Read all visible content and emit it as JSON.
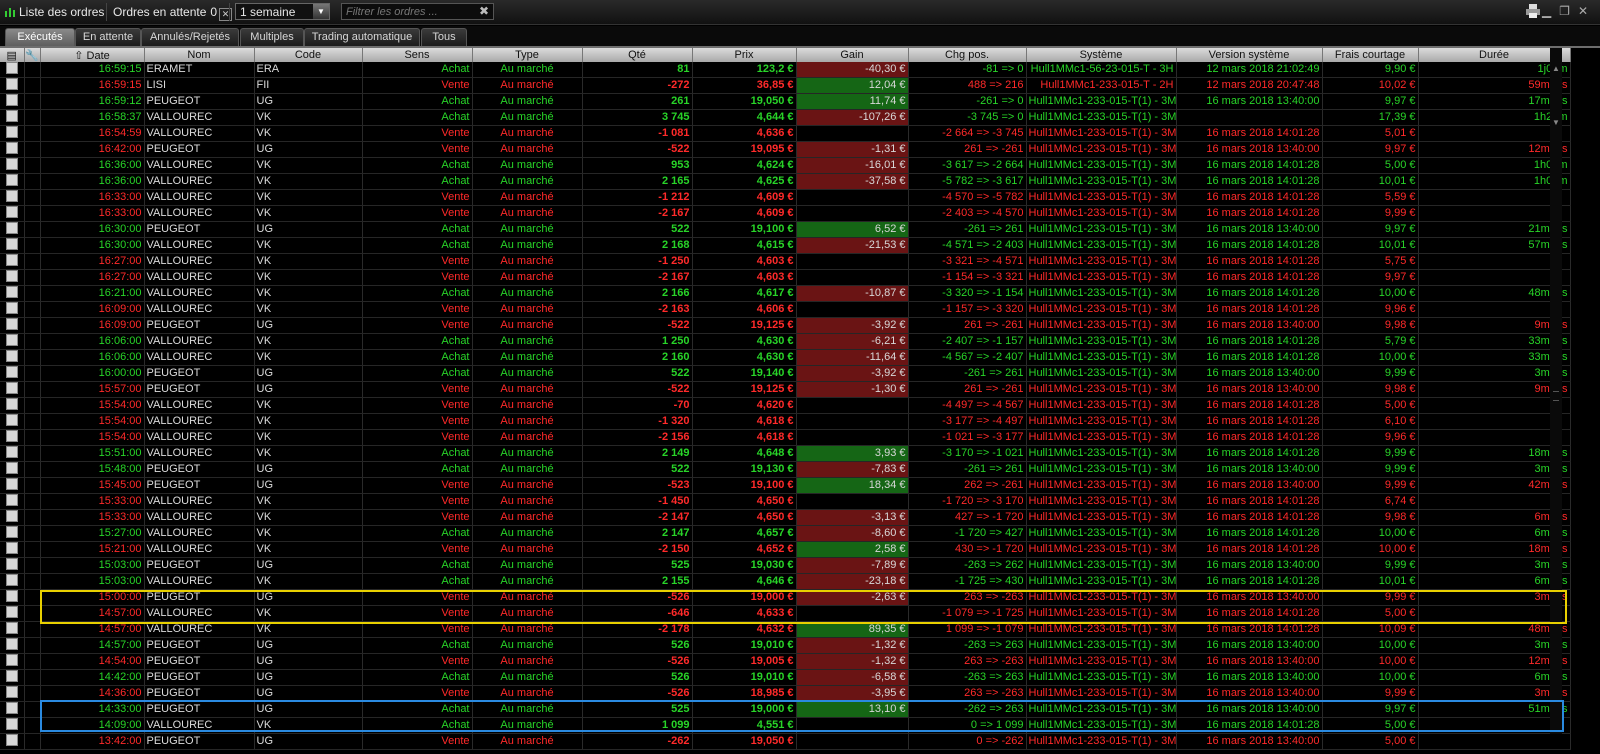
{
  "topbar": {
    "title": "Liste des ordres",
    "pending_label": "Ordres en attente",
    "pending_count": "0",
    "period": "1 semaine",
    "filter_placeholder": "Filtrer les ordres ..."
  },
  "tabs": [
    "Exécutés",
    "En attente",
    "Annulés/Rejetés",
    "Multiples",
    "Trading automatique",
    "Tous"
  ],
  "columns": [
    "Date",
    "Nom",
    "Code",
    "Sens",
    "Type",
    "Qté",
    "Prix",
    "Gain",
    "Chg pos.",
    "Système",
    "Version système",
    "Frais courtage",
    "Durée"
  ],
  "rows": [
    [
      "16:59:15",
      "ERAMET",
      "ERA",
      "Achat",
      "Au marché",
      "81",
      "123,2 €",
      "-40,30 €",
      "-81 => 0",
      "Hull1MMc1-56-23-015-T - 3H",
      "12 mars 2018 21:02:49",
      "9,90 €",
      "1j01m"
    ],
    [
      "16:59:15",
      "LISI",
      "FII",
      "Vente",
      "Au marché",
      "-272",
      "36,85 €",
      "12,04 €",
      "488 => 216",
      "Hull1MMc1-233-015-T - 2H",
      "12 mars 2018 20:47:48",
      "10,02 €",
      "59m14s"
    ],
    [
      "16:59:12",
      "PEUGEOT",
      "UG",
      "Achat",
      "Au marché",
      "261",
      "19,050 €",
      "11,74 €",
      "-261 => 0",
      "Hull1MMc1-233-015-T(1) - 3M",
      "16 mars 2018 13:40:00",
      "9,97 €",
      "17m12s"
    ],
    [
      "16:58:37",
      "VALLOUREC",
      "VK",
      "Achat",
      "Au marché",
      "3 745",
      "4,644 €",
      "-107,26 €",
      "-3 745 => 0",
      "Hull1MMc1-233-015-T(1) - 3M",
      "",
      "17,39 €",
      "1h25m"
    ],
    [
      "16:54:59",
      "VALLOUREC",
      "VK",
      "Vente",
      "Au marché",
      "-1 081",
      "4,636 €",
      "",
      "-2 664 => -3 745",
      "Hull1MMc1-233-015-T(1) - 3M",
      "16 mars 2018 14:01:28",
      "5,01 €",
      ""
    ],
    [
      "16:42:00",
      "PEUGEOT",
      "UG",
      "Vente",
      "Au marché",
      "-522",
      "19,095 €",
      "-1,31 €",
      "261 => -261",
      "Hull1MMc1-233-015-T(1) - 3M",
      "16 mars 2018 13:40:00",
      "9,97 €",
      "12m00s"
    ],
    [
      "16:36:00",
      "VALLOUREC",
      "VK",
      "Achat",
      "Au marché",
      "953",
      "4,624 €",
      "-16,01 €",
      "-3 617 => -2 664",
      "Hull1MMc1-233-015-T(1) - 3M",
      "16 mars 2018 14:01:28",
      "5,00 €",
      "1h03m"
    ],
    [
      "16:36:00",
      "VALLOUREC",
      "VK",
      "Achat",
      "Au marché",
      "2 165",
      "4,625 €",
      "-37,58 €",
      "-5 782 => -3 617",
      "Hull1MMc1-233-015-T(1) - 3M",
      "16 mars 2018 14:01:28",
      "10,01 €",
      "1h03m"
    ],
    [
      "16:33:00",
      "VALLOUREC",
      "VK",
      "Vente",
      "Au marché",
      "-1 212",
      "4,609 €",
      "",
      "-4 570 => -5 782",
      "Hull1MMc1-233-015-T(1) - 3M",
      "16 mars 2018 14:01:28",
      "5,59 €",
      ""
    ],
    [
      "16:33:00",
      "VALLOUREC",
      "VK",
      "Vente",
      "Au marché",
      "-2 167",
      "4,609 €",
      "",
      "-2 403 => -4 570",
      "Hull1MMc1-233-015-T(1) - 3M",
      "16 mars 2018 14:01:28",
      "9,99 €",
      ""
    ],
    [
      "16:30:00",
      "PEUGEOT",
      "UG",
      "Achat",
      "Au marché",
      "522",
      "19,100 €",
      "6,52 €",
      "-261 => 261",
      "Hull1MMc1-233-015-T(1) - 3M",
      "16 mars 2018 13:40:00",
      "9,97 €",
      "21m00s"
    ],
    [
      "16:30:00",
      "VALLOUREC",
      "VK",
      "Achat",
      "Au marché",
      "2 168",
      "4,615 €",
      "-21,53 €",
      "-4 571 => -2 403",
      "Hull1MMc1-233-015-T(1) - 3M",
      "16 mars 2018 14:01:28",
      "10,01 €",
      "57m00s"
    ],
    [
      "16:27:00",
      "VALLOUREC",
      "VK",
      "Vente",
      "Au marché",
      "-1 250",
      "4,603 €",
      "",
      "-3 321 => -4 571",
      "Hull1MMc1-233-015-T(1) - 3M",
      "16 mars 2018 14:01:28",
      "5,75 €",
      ""
    ],
    [
      "16:27:00",
      "VALLOUREC",
      "VK",
      "Vente",
      "Au marché",
      "-2 167",
      "4,603 €",
      "",
      "-1 154 => -3 321",
      "Hull1MMc1-233-015-T(1) - 3M",
      "16 mars 2018 14:01:28",
      "9,97 €",
      ""
    ],
    [
      "16:21:00",
      "VALLOUREC",
      "VK",
      "Achat",
      "Au marché",
      "2 166",
      "4,617 €",
      "-10,87 €",
      "-3 320 => -1 154",
      "Hull1MMc1-233-015-T(1) - 3M",
      "16 mars 2018 14:01:28",
      "10,00 €",
      "48m00s"
    ],
    [
      "16:09:00",
      "VALLOUREC",
      "VK",
      "Vente",
      "Au marché",
      "-2 163",
      "4,606 €",
      "",
      "-1 157 => -3 320",
      "Hull1MMc1-233-015-T(1) - 3M",
      "16 mars 2018 14:01:28",
      "9,96 €",
      ""
    ],
    [
      "16:09:00",
      "PEUGEOT",
      "UG",
      "Vente",
      "Au marché",
      "-522",
      "19,125 €",
      "-3,92 €",
      "261 => -261",
      "Hull1MMc1-233-015-T(1) - 3M",
      "16 mars 2018 13:40:00",
      "9,98 €",
      "9m00s"
    ],
    [
      "16:06:00",
      "VALLOUREC",
      "VK",
      "Achat",
      "Au marché",
      "1 250",
      "4,630 €",
      "-6,21 €",
      "-2 407 => -1 157",
      "Hull1MMc1-233-015-T(1) - 3M",
      "16 mars 2018 14:01:28",
      "5,79 €",
      "33m00s"
    ],
    [
      "16:06:00",
      "VALLOUREC",
      "VK",
      "Achat",
      "Au marché",
      "2 160",
      "4,630 €",
      "-11,64 €",
      "-4 567 => -2 407",
      "Hull1MMc1-233-015-T(1) - 3M",
      "16 mars 2018 14:01:28",
      "10,00 €",
      "33m00s"
    ],
    [
      "16:00:00",
      "PEUGEOT",
      "UG",
      "Achat",
      "Au marché",
      "522",
      "19,140 €",
      "-3,92 €",
      "-261 => 261",
      "Hull1MMc1-233-015-T(1) - 3M",
      "16 mars 2018 13:40:00",
      "9,99 €",
      "3m00s"
    ],
    [
      "15:57:00",
      "PEUGEOT",
      "UG",
      "Vente",
      "Au marché",
      "-522",
      "19,125 €",
      "-1,30 €",
      "261 => -261",
      "Hull1MMc1-233-015-T(1) - 3M",
      "16 mars 2018 13:40:00",
      "9,98 €",
      "9m00s"
    ],
    [
      "15:54:00",
      "VALLOUREC",
      "VK",
      "Vente",
      "Au marché",
      "-70",
      "4,620 €",
      "",
      "-4 497 => -4 567",
      "Hull1MMc1-233-015-T(1) - 3M",
      "16 mars 2018 14:01:28",
      "5,00 €",
      ""
    ],
    [
      "15:54:00",
      "VALLOUREC",
      "VK",
      "Vente",
      "Au marché",
      "-1 320",
      "4,618 €",
      "",
      "-3 177 => -4 497",
      "Hull1MMc1-233-015-T(1) - 3M",
      "16 mars 2018 14:01:28",
      "6,10 €",
      ""
    ],
    [
      "15:54:00",
      "VALLOUREC",
      "VK",
      "Vente",
      "Au marché",
      "-2 156",
      "4,618 €",
      "",
      "-1 021 => -3 177",
      "Hull1MMc1-233-015-T(1) - 3M",
      "16 mars 2018 14:01:28",
      "9,96 €",
      ""
    ],
    [
      "15:51:00",
      "VALLOUREC",
      "VK",
      "Achat",
      "Au marché",
      "2 149",
      "4,648 €",
      "3,93 €",
      "-3 170 => -1 021",
      "Hull1MMc1-233-015-T(1) - 3M",
      "16 mars 2018 14:01:28",
      "9,99 €",
      "18m00s"
    ],
    [
      "15:48:00",
      "PEUGEOT",
      "UG",
      "Achat",
      "Au marché",
      "522",
      "19,130 €",
      "-7,83 €",
      "-261 => 261",
      "Hull1MMc1-233-015-T(1) - 3M",
      "16 mars 2018 13:40:00",
      "9,99 €",
      "3m00s"
    ],
    [
      "15:45:00",
      "PEUGEOT",
      "UG",
      "Vente",
      "Au marché",
      "-523",
      "19,100 €",
      "18,34 €",
      "262 => -261",
      "Hull1MMc1-233-015-T(1) - 3M",
      "16 mars 2018 13:40:00",
      "9,99 €",
      "42m00s"
    ],
    [
      "15:33:00",
      "VALLOUREC",
      "VK",
      "Vente",
      "Au marché",
      "-1 450",
      "4,650 €",
      "",
      "-1 720 => -3 170",
      "Hull1MMc1-233-015-T(1) - 3M",
      "16 mars 2018 14:01:28",
      "6,74 €",
      ""
    ],
    [
      "15:33:00",
      "VALLOUREC",
      "VK",
      "Vente",
      "Au marché",
      "-2 147",
      "4,650 €",
      "-3,13 €",
      "427 => -1 720",
      "Hull1MMc1-233-015-T(1) - 3M",
      "16 mars 2018 14:01:28",
      "9,98 €",
      "6m00s"
    ],
    [
      "15:27:00",
      "VALLOUREC",
      "VK",
      "Achat",
      "Au marché",
      "2 147",
      "4,657 €",
      "-8,60 €",
      "-1 720 => 427",
      "Hull1MMc1-233-015-T(1) - 3M",
      "16 mars 2018 14:01:28",
      "10,00 €",
      "6m00s"
    ],
    [
      "15:21:00",
      "VALLOUREC",
      "VK",
      "Vente",
      "Au marché",
      "-2 150",
      "4,652 €",
      "2,58 €",
      "430 => -1 720",
      "Hull1MMc1-233-015-T(1) - 3M",
      "16 mars 2018 14:01:28",
      "10,00 €",
      "18m00s"
    ],
    [
      "15:03:00",
      "PEUGEOT",
      "UG",
      "Achat",
      "Au marché",
      "525",
      "19,030 €",
      "-7,89 €",
      "-263 => 262",
      "Hull1MMc1-233-015-T(1) - 3M",
      "16 mars 2018 13:40:00",
      "9,99 €",
      "3m00s"
    ],
    [
      "15:03:00",
      "VALLOUREC",
      "VK",
      "Achat",
      "Au marché",
      "2 155",
      "4,646 €",
      "-23,18 €",
      "-1 725 => 430",
      "Hull1MMc1-233-015-T(1) - 3M",
      "16 mars 2018 14:01:28",
      "10,01 €",
      "6m00s"
    ],
    [
      "15:00:00",
      "PEUGEOT",
      "UG",
      "Vente",
      "Au marché",
      "-526",
      "19,000 €",
      "-2,63 €",
      "263 => -263",
      "Hull1MMc1-233-015-T(1) - 3M",
      "16 mars 2018 13:40:00",
      "9,99 €",
      "3m00s"
    ],
    [
      "14:57:00",
      "VALLOUREC",
      "VK",
      "Vente",
      "Au marché",
      "-646",
      "4,633 €",
      "",
      "-1 079 => -1 725",
      "Hull1MMc1-233-015-T(1) - 3M",
      "16 mars 2018 14:01:28",
      "5,00 €",
      ""
    ],
    [
      "14:57:00",
      "VALLOUREC",
      "VK",
      "Vente",
      "Au marché",
      "-2 178",
      "4,632 €",
      "89,35 €",
      "1 099 => -1 079",
      "Hull1MMc1-233-015-T(1) - 3M",
      "16 mars 2018 14:01:28",
      "10,09 €",
      "48m00s"
    ],
    [
      "14:57:00",
      "PEUGEOT",
      "UG",
      "Achat",
      "Au marché",
      "526",
      "19,010 €",
      "-1,32 €",
      "-263 => 263",
      "Hull1MMc1-233-015-T(1) - 3M",
      "16 mars 2018 13:40:00",
      "10,00 €",
      "3m00s"
    ],
    [
      "14:54:00",
      "PEUGEOT",
      "UG",
      "Vente",
      "Au marché",
      "-526",
      "19,005 €",
      "-1,32 €",
      "263 => -263",
      "Hull1MMc1-233-015-T(1) - 3M",
      "16 mars 2018 13:40:00",
      "10,00 €",
      "12m00s"
    ],
    [
      "14:42:00",
      "PEUGEOT",
      "UG",
      "Achat",
      "Au marché",
      "526",
      "19,010 €",
      "-6,58 €",
      "-263 => 263",
      "Hull1MMc1-233-015-T(1) - 3M",
      "16 mars 2018 13:40:00",
      "10,00 €",
      "6m00s"
    ],
    [
      "14:36:00",
      "PEUGEOT",
      "UG",
      "Vente",
      "Au marché",
      "-526",
      "18,985 €",
      "-3,95 €",
      "263 => -263",
      "Hull1MMc1-233-015-T(1) - 3M",
      "16 mars 2018 13:40:00",
      "9,99 €",
      "3m00s"
    ],
    [
      "14:33:00",
      "PEUGEOT",
      "UG",
      "Achat",
      "Au marché",
      "525",
      "19,000 €",
      "13,10 €",
      "-262 => 263",
      "Hull1MMc1-233-015-T(1) - 3M",
      "16 mars 2018 13:40:00",
      "9,97 €",
      "51m00s"
    ],
    [
      "14:09:00",
      "VALLOUREC",
      "VK",
      "Achat",
      "Au marché",
      "1 099",
      "4,551 €",
      "",
      "0 => 1 099",
      "Hull1MMc1-233-015-T(1) - 3M",
      "16 mars 2018 14:01:28",
      "5,00 €",
      ""
    ],
    [
      "13:42:00",
      "PEUGEOT",
      "UG",
      "Vente",
      "Au marché",
      "-262",
      "19,050 €",
      "",
      "0 => -262",
      "Hull1MMc1-233-015-T(1) - 3M",
      "16 mars 2018 13:40:00",
      "5,00 €",
      ""
    ]
  ],
  "colors": {
    "buy": "#28d428",
    "sell": "#ff2a2a",
    "gain_positive_bg": "#156615",
    "gain_negative_bg": "#6a1414",
    "highlight_yellow": "#e8d000",
    "highlight_blue": "#2a8ae0"
  },
  "icons": [
    "chart-icon",
    "filter-clear-icon",
    "printer-icon",
    "minimize-icon",
    "restore-icon",
    "close-icon",
    "order-detail-icon",
    "wrench-icon",
    "sort-asc-icon"
  ]
}
